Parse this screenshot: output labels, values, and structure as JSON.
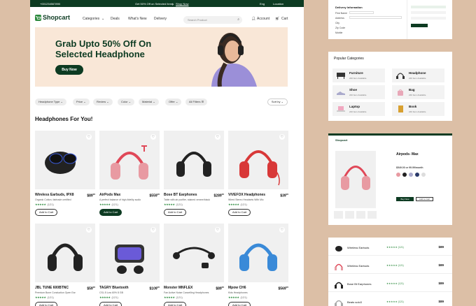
{
  "topbar": {
    "phone": "+001234567890",
    "promo": "Get 50% Off on Selected Items",
    "divider": "|",
    "shop_now": "Shop Now",
    "language": "Eng",
    "location": "Location"
  },
  "nav": {
    "logo": "Shopcart",
    "links": [
      "Categories",
      "Deals",
      "What's New",
      "Delivery"
    ],
    "search_placeholder": "Search Product",
    "account": "Account",
    "cart": "Cart"
  },
  "hero": {
    "headline": "Grab Upto 50% Off On Selected Headphone",
    "button": "Buy Now"
  },
  "filters": [
    "Headphone Type",
    "Price",
    "Review",
    "Color",
    "Material",
    "Offer",
    "All Filters"
  ],
  "sort": "Sort by",
  "section_title": "Headphones For You!",
  "products": [
    {
      "name": "Wireless Earbuds, IPX8",
      "price": "$89",
      "cents": "00",
      "desc": "Organic Cotton, fairtrade certified",
      "stars": "★★★★★",
      "reviews": "(121)",
      "button": "Add to Cart",
      "active": false
    },
    {
      "name": "AirPods Max",
      "price": "$559",
      "cents": "00",
      "desc": "A perfect balance of high-fidelity audio",
      "stars": "★★★★★",
      "reviews": "(121)",
      "button": "Add to Cart",
      "active": true
    },
    {
      "name": "Bose BT Earphones",
      "price": "$289",
      "cents": "00",
      "desc": "Table with air purifier, stained veneer/black",
      "stars": "★★★★★",
      "reviews": "(121)",
      "button": "Add to Cart",
      "active": false
    },
    {
      "name": "VIVEFOX Headphones",
      "price": "$39",
      "cents": "00",
      "desc": "Wired Stereo Headsets With Mic",
      "stars": "★★★★★",
      "reviews": "(121)",
      "button": "Add to Cart",
      "active": false
    },
    {
      "name": "JBL TUNE 600BTNC",
      "price": "$59",
      "cents": "00",
      "desc": "Premium Bone Conduction Open Ear",
      "stars": "★★★★★",
      "reviews": "(121)",
      "button": "Add to Cart",
      "active": false
    },
    {
      "name": "TAGRY Bluetooth",
      "price": "$109",
      "cents": "00",
      "desc": "CSL 8 Low 60% 8 GB",
      "stars": "★★★★★",
      "reviews": "(121)",
      "button": "Add to Cart",
      "active": false
    },
    {
      "name": "Monster MNFLEX",
      "price": "$89",
      "cents": "00",
      "desc": "Fan Active Noise Cancelling Headphones",
      "stars": "★★★★★",
      "reviews": "(121)",
      "button": "Add to Cart",
      "active": false
    },
    {
      "name": "Mpow CH6",
      "price": "$569",
      "cents": "00",
      "desc": "Kids Headphones",
      "stars": "★★★★★",
      "reviews": "(121)",
      "button": "Add to Cart",
      "active": false
    }
  ],
  "side_delivery": {
    "title": "Delivery Information",
    "labels": [
      "First Name",
      "Address",
      "City",
      "Zip Code",
      "Mobile",
      "Email"
    ]
  },
  "side_categories": {
    "title": "Popular Categories",
    "items": [
      {
        "name": "Furniture",
        "count": "240 Item Available"
      },
      {
        "name": "Headphone",
        "count": "240 Item Available"
      },
      {
        "name": "Shoe",
        "count": "240 Item Available"
      },
      {
        "name": "Bag",
        "count": "240 Item Available"
      },
      {
        "name": "Laptop",
        "count": "240 Item Available"
      },
      {
        "name": "Book",
        "count": "240 Item Available"
      }
    ]
  },
  "side_product": {
    "logo": "Shopcart",
    "title": "Airpods- Max",
    "price": "$549.00 or 99.99/month",
    "buy": "Buy Now",
    "add": "Add to Cart"
  },
  "side_list": [
    {
      "name": "Wireless Earbuds",
      "stars": "★★★★★ (121)",
      "price": "$89"
    },
    {
      "name": "Wireless Earbuds",
      "stars": "★★★★★ (121)",
      "price": "$89"
    },
    {
      "name": "Bose Bt Earphones",
      "stars": "★★★★★ (121)",
      "price": "$89"
    },
    {
      "name": "Beats solo3",
      "stars": "★★★★★ (121)",
      "price": "$89"
    }
  ],
  "colors": {
    "brand": "#0d3b22",
    "accent": "#2d8a3e",
    "background": "#dcbfa6",
    "hero": "#f9e7d7"
  }
}
